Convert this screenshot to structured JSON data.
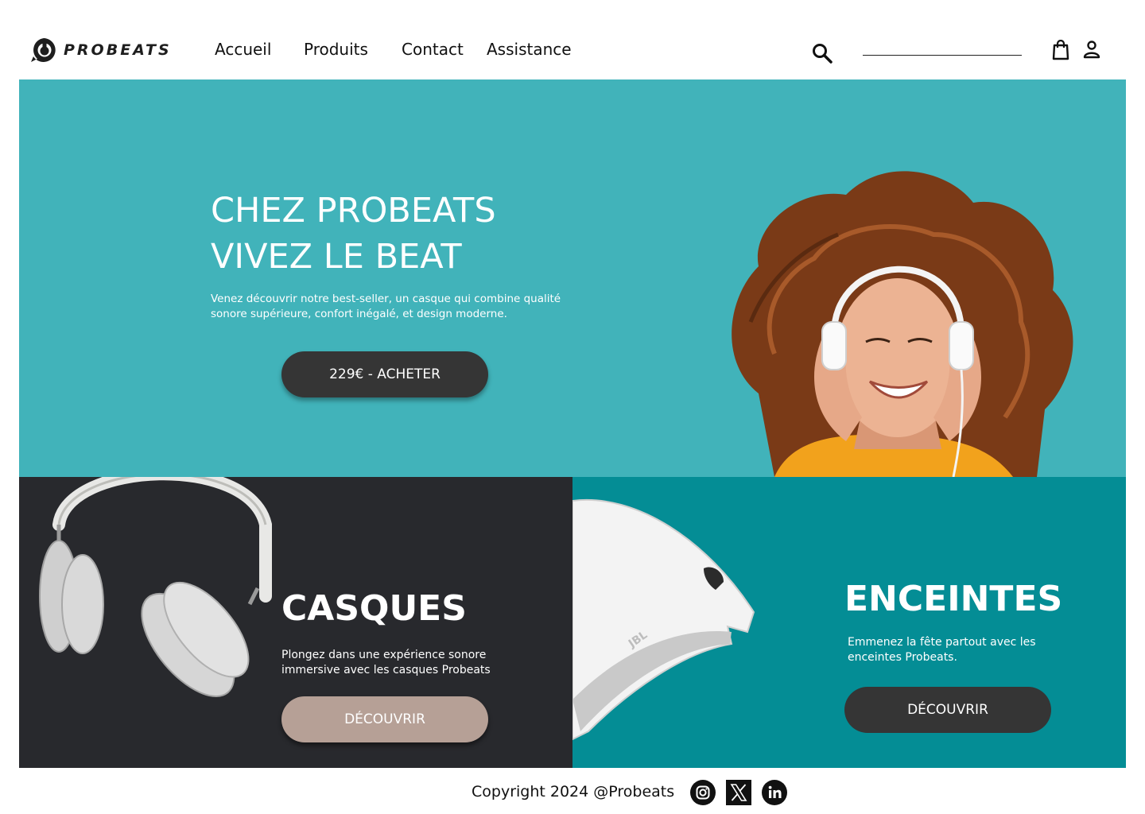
{
  "brand": {
    "name": "PROBEATS"
  },
  "nav": {
    "items": [
      {
        "label": "Accueil"
      },
      {
        "label": "Produits"
      },
      {
        "label": "Contact"
      },
      {
        "label": "Assistance"
      }
    ]
  },
  "header_icons": [
    "search-icon",
    "shopping-bag-icon",
    "user-icon"
  ],
  "search": {
    "placeholder": ""
  },
  "hero": {
    "title_line1": "CHEZ PROBEATS",
    "title_line2": "VIVEZ LE BEAT",
    "description": " Venez découvrir notre best-seller, un casque qui combine qualité sonore supérieure, confort inégalé, et design moderne.",
    "button_label": "229€ - ACHETER"
  },
  "categories": {
    "casques": {
      "title": "CASQUES",
      "description": "Plongez dans une expérience sonore immersive avec les casques Probeats",
      "button_label": "DÉCOUVRIR"
    },
    "enceintes": {
      "title": "ENCEINTES",
      "description": "Emmenez la fête partout avec les enceintes Probeats.",
      "button_label": "DÉCOUVRIR"
    }
  },
  "product_image_text": {
    "speaker_brand": "JBL"
  },
  "footer": {
    "copyright": "Copyright 2024 @Probeats",
    "social": [
      "instagram-icon",
      "x-twitter-icon",
      "linkedin-icon"
    ]
  },
  "colors": {
    "hero_bg": "#41b3ba",
    "card_dark": "#28292d",
    "card_teal": "#048d95",
    "button_dark": "#353535",
    "button_taupe": "#b6a096"
  }
}
